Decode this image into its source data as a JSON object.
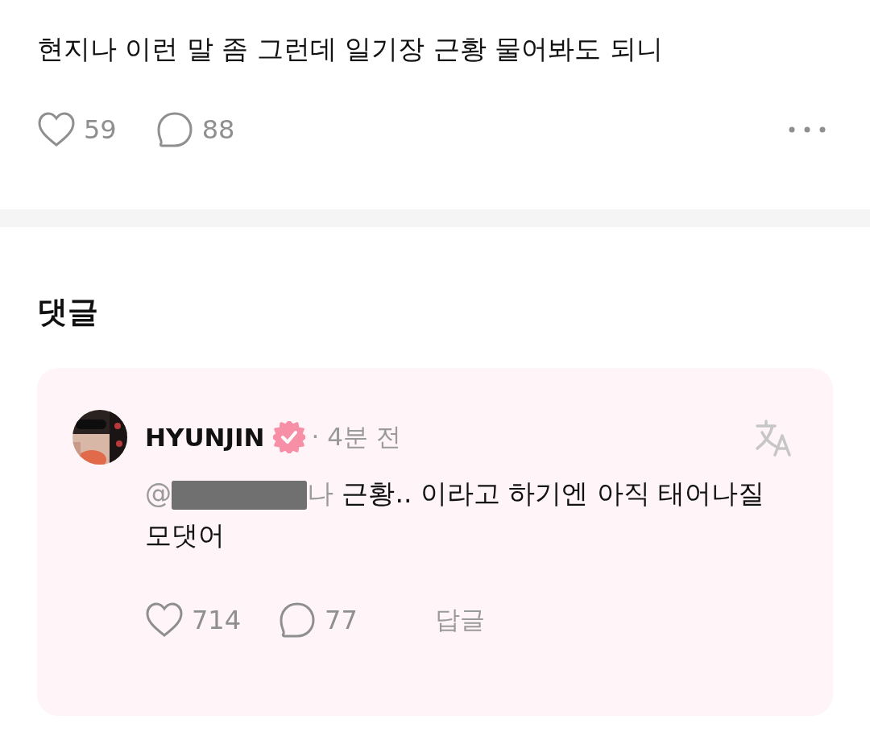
{
  "post": {
    "text": "현지나 이런 말 좀 그런데 일기장 근황 물어봐도 되니",
    "likes": "59",
    "comments": "88",
    "liked": false
  },
  "comments_section": {
    "title": "댓글",
    "comments": [
      {
        "author": "HYUNJIN",
        "verified": true,
        "time": "· 4분 전",
        "mention_start": "@",
        "redacted": true,
        "mention_end": "나",
        "text": "근황.. 이라고 하기엔 아직 태어나질 모댓어",
        "likes": "714",
        "replies": "77",
        "reply_label": "답글",
        "liked": false
      }
    ]
  }
}
